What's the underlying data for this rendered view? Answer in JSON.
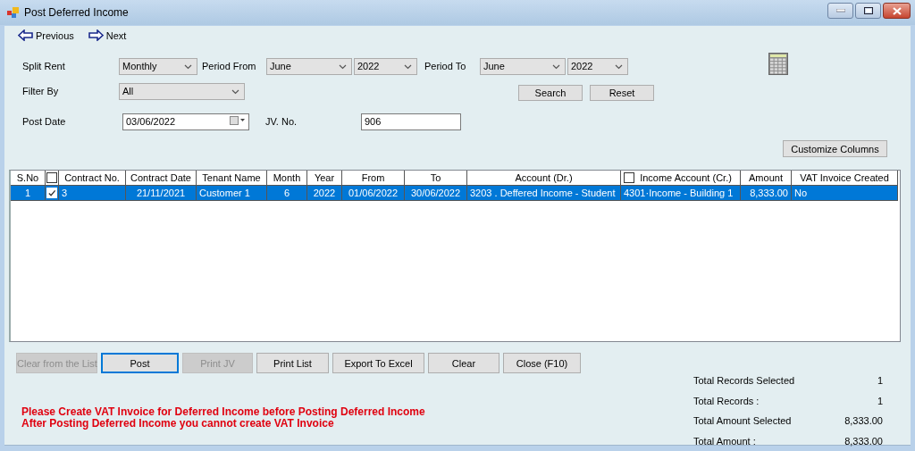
{
  "window": {
    "title": "Post Deferred Income"
  },
  "nav": [
    {
      "label": "Previous",
      "kind": "back"
    },
    {
      "label": "Next",
      "kind": "forward"
    }
  ],
  "filters": {
    "split_rent": {
      "label": "Split Rent",
      "value": "Monthly"
    },
    "period_from": {
      "label": "Period From",
      "month": "June",
      "year": "2022"
    },
    "period_to": {
      "label": "Period To",
      "month": "June",
      "year": "2022"
    },
    "filter_by": {
      "label": "Filter By",
      "value": "All"
    },
    "post_date": {
      "label": "Post Date",
      "value": "03/06/2022"
    },
    "jv_no": {
      "label": "JV. No.",
      "value": "906"
    }
  },
  "search_buttons": [
    "Search",
    "Reset"
  ],
  "customize_button": "Customize Columns",
  "table": {
    "columns": [
      {
        "kind": "text",
        "label": "S.No"
      },
      {
        "kind": "checkbox",
        "checked": false
      },
      {
        "kind": "text",
        "label": "Contract No."
      },
      {
        "kind": "text",
        "label": "Contract Date"
      },
      {
        "kind": "text",
        "label": "Tenant Name"
      },
      {
        "kind": "text",
        "label": "Month"
      },
      {
        "kind": "text",
        "label": "Year"
      },
      {
        "kind": "text",
        "label": "From"
      },
      {
        "kind": "text",
        "label": "To"
      },
      {
        "kind": "text",
        "label": "Account  (Dr.)"
      },
      {
        "kind": "checkbox_text",
        "label": "Income Account (Cr.)",
        "checked": false
      },
      {
        "kind": "text",
        "label": "Amount"
      },
      {
        "kind": "text",
        "label": "VAT Invoice Created"
      }
    ],
    "rows": [
      {
        "selected": true,
        "cells": [
          "1",
          {
            "kind": "checkbox",
            "checked": true
          },
          "3",
          "21/11/2021",
          "Customer 1",
          "6",
          "2022",
          "01/06/2022",
          "30/06/2022",
          "3203 . Deffered Income - Student",
          "4301·Income - Building 1",
          "8,333.00",
          "No"
        ]
      }
    ]
  },
  "actions": [
    {
      "label": "Clear from the List",
      "disabled": true,
      "focused": false
    },
    {
      "label": "Post",
      "disabled": false,
      "focused": true
    },
    {
      "label": "Print JV",
      "disabled": true,
      "focused": false
    },
    {
      "label": "Print List",
      "disabled": false,
      "focused": false
    },
    {
      "label": "Export To Excel",
      "disabled": false,
      "focused": false
    },
    {
      "label": "Clear",
      "disabled": false,
      "focused": false
    },
    {
      "label": "Close (F10)",
      "disabled": false,
      "focused": false
    }
  ],
  "messages": [
    "Please Create VAT Invoice for Deferred Income before Posting Deferred Income",
    "After Posting Deferred Income you cannot create VAT Invoice"
  ],
  "totals": [
    {
      "label": "Total Records  Selected",
      "value": "1"
    },
    {
      "label": "Total Records :",
      "value": "1"
    },
    {
      "label": "Total Amount Selected",
      "value": "8,333.00"
    },
    {
      "label": "Total Amount :",
      "value": "8,333.00"
    }
  ]
}
